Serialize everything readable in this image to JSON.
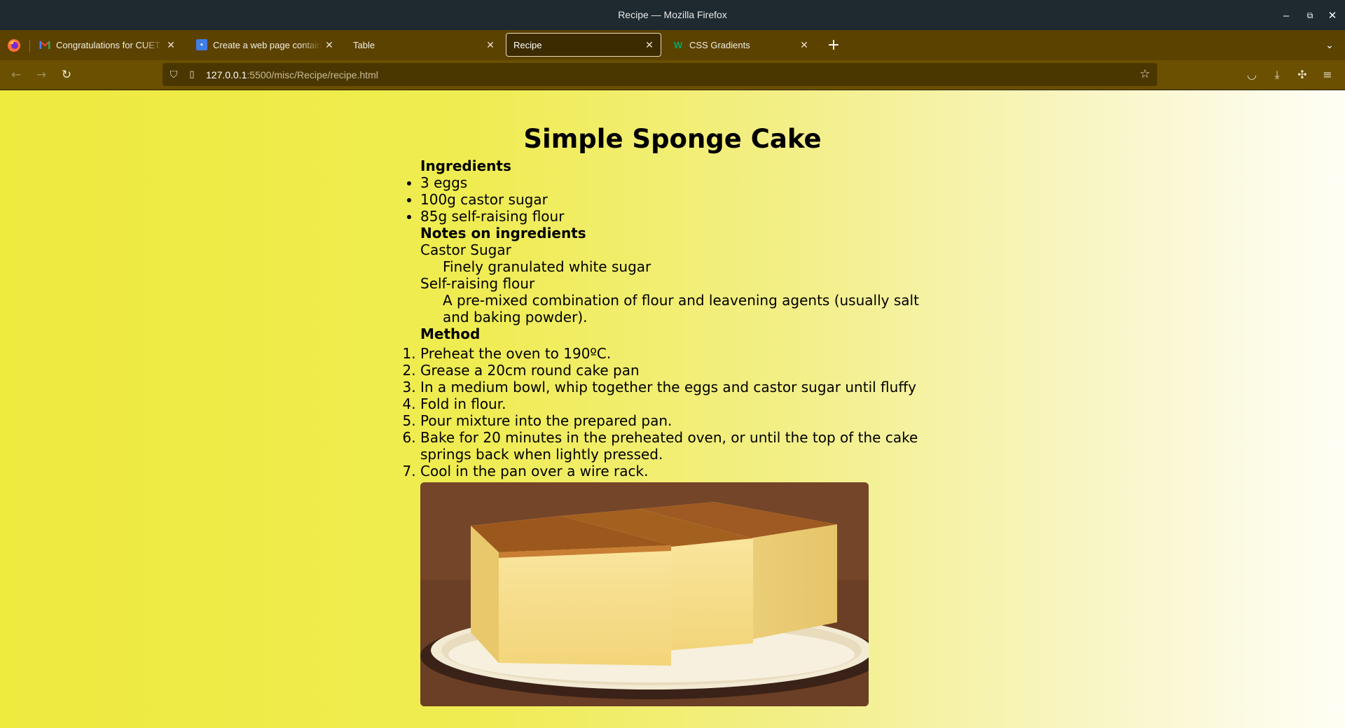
{
  "window": {
    "title": "Recipe — Mozilla Firefox",
    "controls": {
      "minimize": "–",
      "restore": "⧉",
      "close": "✕"
    }
  },
  "tabs": [
    {
      "label": "Congratulations for CUET P",
      "favicon": "gmail-icon",
      "active": false
    },
    {
      "label": "Create a web page containi",
      "favicon": "classroom-icon",
      "active": false
    },
    {
      "label": "Table",
      "favicon": "",
      "active": false
    },
    {
      "label": "Recipe",
      "favicon": "",
      "active": true
    },
    {
      "label": "CSS Gradients",
      "favicon": "w3schools-icon",
      "active": false
    }
  ],
  "navbar": {
    "url_host": "127.0.0.1",
    "url_path": ":5500/misc/Recipe/recipe.html"
  },
  "recipe": {
    "title": "Simple Sponge Cake",
    "ingredients_heading": "Ingredients",
    "ingredients": [
      "3 eggs",
      "100g castor sugar",
      "85g self-raising flour"
    ],
    "notes_heading": "Notes on ingredients",
    "notes": [
      {
        "term": "Castor Sugar",
        "definition": "Finely granulated white sugar"
      },
      {
        "term": "Self-raising flour",
        "definition": "A pre-mixed combination of flour and leavening agents (usually salt and baking powder)."
      }
    ],
    "method_heading": "Method",
    "method": [
      "Preheat the oven to 190ºC.",
      "Grease a 20cm round cake pan",
      "In a medium bowl, whip together the eggs and castor sugar until fluffy",
      "Fold in flour.",
      "Pour mixture into the prepared pan.",
      "Bake for 20 minutes in the preheated oven, or until the top of the cake springs back when lightly pressed.",
      "Cool in the pan over a wire rack."
    ]
  },
  "colors": {
    "titlebar": "#1e2a30",
    "tabbar": "#5b4200",
    "navbar": "#6a5000",
    "page_gradient_start": "#eeea3e",
    "page_gradient_end": "#fffef6"
  }
}
